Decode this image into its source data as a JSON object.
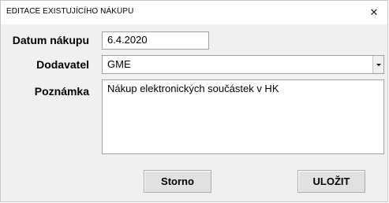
{
  "window": {
    "title": "EDITACE EXISTUJÍCÍHO NÁKUPU",
    "close_glyph": "✕"
  },
  "form": {
    "date_label": "Datum nákupu",
    "date_value": "6.4.2020",
    "supplier_label": "Dodavatel",
    "supplier_value": "GME",
    "note_label": "Poznámka",
    "note_value": "Nákup elektronických součástek v HK"
  },
  "buttons": {
    "cancel_label": "Storno",
    "save_label": "ULOŽIT"
  }
}
